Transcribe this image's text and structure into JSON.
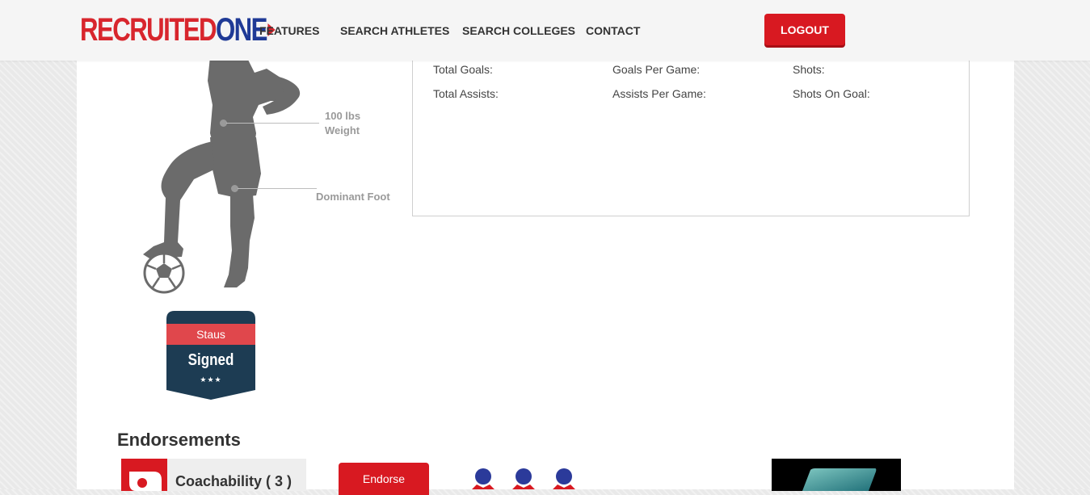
{
  "header": {
    "logo": {
      "part_a": "RECRUITED",
      "part_b": "ONE"
    },
    "nav": [
      {
        "label": "FEATURES"
      },
      {
        "label": "SEARCH ATHLETES"
      },
      {
        "label": "SEARCH COLLEGES"
      },
      {
        "label": "CONTACT"
      }
    ],
    "logout_label": "LOGOUT"
  },
  "stats": {
    "col1": [
      "Total Goals:",
      "Total Assists:"
    ],
    "col2": [
      "Goals Per Game:",
      "Assists Per Game:"
    ],
    "col3": [
      "Shots:",
      "Shots On Goal:"
    ]
  },
  "player": {
    "weight_value": "100 lbs",
    "weight_label": "Weight",
    "foot_label": "Dominant Foot"
  },
  "status_badge": {
    "label": "Staus",
    "value": "Signed",
    "stars": "★★★"
  },
  "endorsements": {
    "title": "Endorsements",
    "card_label": "Coachability ( 3 )",
    "button_label": "Endorse"
  },
  "colors": {
    "brand_red": "#d81921",
    "brand_blue": "#1f3a96",
    "badge_navy": "#1d3c53",
    "badge_red": "#e0474c",
    "silhouette": "#6b6b6b"
  }
}
